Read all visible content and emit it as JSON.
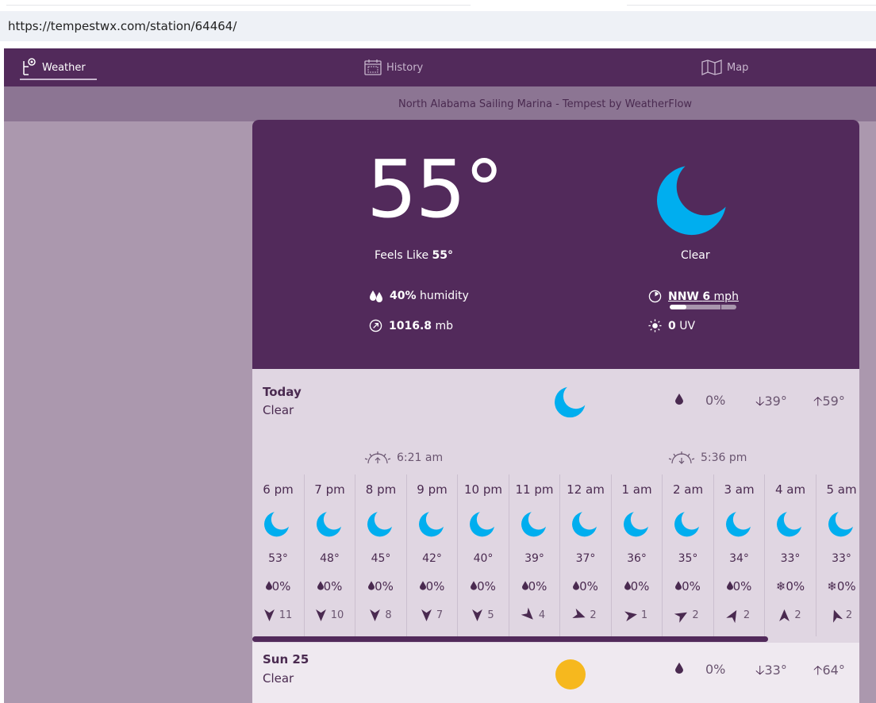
{
  "browser": {
    "url": "https://tempestwx.com/station/64464/"
  },
  "nav": {
    "weather_label": "Weather",
    "history_label": "History",
    "map_label": "Map"
  },
  "station_title": "North Alabama Sailing Marina - Tempest by WeatherFlow",
  "current": {
    "temperature": "55°",
    "feels_like_label": "Feels Like",
    "feels_like_value": "55°",
    "condition": "Clear",
    "humidity_value": "40%",
    "humidity_label": "humidity",
    "pressure_value": "1016.8",
    "pressure_unit": "mb",
    "wind_direction": "NNW",
    "wind_speed": "6",
    "wind_unit": "mph",
    "wind_bar_fraction": 0.25,
    "uv_value": "0",
    "uv_label": "UV"
  },
  "today": {
    "name": "Today",
    "condition": "Clear",
    "precip": "0%",
    "low": "39°",
    "high": "59°"
  },
  "sunrise": "6:21 am",
  "sunset": "5:36 pm",
  "hourly": [
    {
      "time": "6 pm",
      "temp": "53°",
      "precip": "0%",
      "precip_type": "rain",
      "wind": "11",
      "wind_dir_deg": 180
    },
    {
      "time": "7 pm",
      "temp": "48°",
      "precip": "0%",
      "precip_type": "rain",
      "wind": "10",
      "wind_dir_deg": 180
    },
    {
      "time": "8 pm",
      "temp": "45°",
      "precip": "0%",
      "precip_type": "rain",
      "wind": "8",
      "wind_dir_deg": 180
    },
    {
      "time": "9 pm",
      "temp": "42°",
      "precip": "0%",
      "precip_type": "rain",
      "wind": "7",
      "wind_dir_deg": 180
    },
    {
      "time": "10 pm",
      "temp": "40°",
      "precip": "0%",
      "precip_type": "rain",
      "wind": "5",
      "wind_dir_deg": 180
    },
    {
      "time": "11 pm",
      "temp": "39°",
      "precip": "0%",
      "precip_type": "rain",
      "wind": "4",
      "wind_dir_deg": 135
    },
    {
      "time": "12 am",
      "temp": "37°",
      "precip": "0%",
      "precip_type": "rain",
      "wind": "2",
      "wind_dir_deg": 110
    },
    {
      "time": "1 am",
      "temp": "36°",
      "precip": "0%",
      "precip_type": "rain",
      "wind": "1",
      "wind_dir_deg": 80
    },
    {
      "time": "2 am",
      "temp": "35°",
      "precip": "0%",
      "precip_type": "rain",
      "wind": "2",
      "wind_dir_deg": 60
    },
    {
      "time": "3 am",
      "temp": "34°",
      "precip": "0%",
      "precip_type": "rain",
      "wind": "2",
      "wind_dir_deg": 30
    },
    {
      "time": "4 am",
      "temp": "33°",
      "precip": "0%",
      "precip_type": "snow",
      "wind": "2",
      "wind_dir_deg": 0
    },
    {
      "time": "5 am",
      "temp": "33°",
      "precip": "0%",
      "precip_type": "snow",
      "wind": "2",
      "wind_dir_deg": 340
    }
  ],
  "scroll_fraction": 0.85,
  "sunday": {
    "name": "Sun 25",
    "condition": "Clear",
    "precip": "0%",
    "low": "33°",
    "high": "64°"
  },
  "colors": {
    "brand_purple": "#522a5b",
    "moon_blue": "#00aeef",
    "sun_yellow": "#f6b81e"
  },
  "icons": {
    "nav_weather": "tempest-station-icon",
    "nav_history": "calendar-icon",
    "nav_map": "map-icon",
    "condition": "moon-icon",
    "humidity": "droplets-icon",
    "pressure": "gauge-icon",
    "wind": "wind-dial-icon",
    "uv": "sun-small-icon",
    "sunrise": "sunrise-icon",
    "sunset": "sunset-icon"
  }
}
